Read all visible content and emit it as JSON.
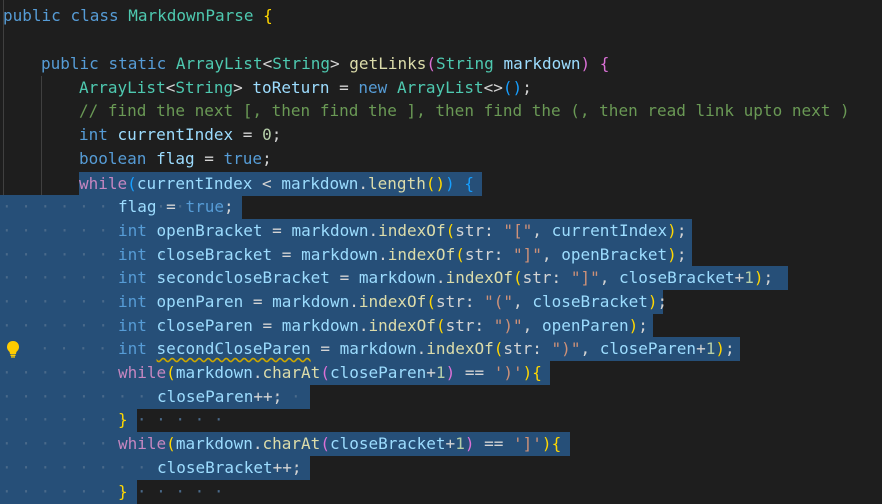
{
  "editor": {
    "language": "java",
    "theme_colors": {
      "background": "#1e1e1e",
      "selection": "#264f78",
      "keyword": "#569cd6",
      "control": "#c586c0",
      "type": "#4ec9b0",
      "function": "#dcdcaa",
      "variable": "#9cdcfe",
      "string": "#ce9178",
      "number": "#b5cea8",
      "comment": "#6a9955",
      "warning_squiggle": "#cca700"
    },
    "lightbulb_icon": "lightbulb-icon",
    "hint_label": "str:",
    "code": {
      "l1_a": "public",
      "l1_b": "class",
      "l1_c": "MarkdownParse",
      "l1_d": "{",
      "l3_a": "public",
      "l3_b": "static",
      "l3_c": "ArrayList",
      "l3_d": "<",
      "l3_e": "String",
      "l3_f": ">",
      "l3_g": "getLinks",
      "l3_h": "(",
      "l3_i": "String",
      "l3_j": "markdown",
      "l3_k": ")",
      "l3_l": "{",
      "l4_a": "ArrayList",
      "l4_b": "<",
      "l4_c": "String",
      "l4_d": ">",
      "l4_e": "toReturn",
      "l4_f": "=",
      "l4_g": "new",
      "l4_h": "ArrayList",
      "l4_i": "<>",
      "l4_j": "()",
      "l4_k": ";",
      "l5": "// find the next [, then find the ], then find the (, then read link upto next )",
      "l6_a": "int",
      "l6_b": "currentIndex",
      "l6_c": "=",
      "l6_d": "0",
      "l6_e": ";",
      "l7_a": "boolean",
      "l7_b": "flag",
      "l7_c": "=",
      "l7_d": "true",
      "l7_e": ";",
      "l8_a": "while",
      "l8_b": "(",
      "l8_c": "currentIndex",
      "l8_d": "<",
      "l8_e": "markdown",
      "l8_f": ".",
      "l8_g": "length",
      "l8_h": "()",
      "l8_i": ")",
      "l8_j": "{",
      "l9_a": "flag",
      "l9_b": "=",
      "l9_c": "true",
      "l9_d": ";",
      "l10_a": "int",
      "l10_b": "openBracket",
      "l10_c": "=",
      "l10_d": "markdown",
      "l10_e": ".",
      "l10_f": "indexOf",
      "l10_g": "(",
      "l10_h": "\"[\"",
      "l10_i": ",",
      "l10_j": "currentIndex",
      "l10_k": ")",
      "l10_l": ";",
      "l11_a": "int",
      "l11_b": "closeBracket",
      "l11_c": "=",
      "l11_d": "markdown",
      "l11_e": ".",
      "l11_f": "indexOf",
      "l11_g": "(",
      "l11_h": "\"]\"",
      "l11_i": ",",
      "l11_j": "openBracket",
      "l11_k": ")",
      "l11_l": ";",
      "l12_a": "int",
      "l12_b": "secondcloseBracket",
      "l12_c": "=",
      "l12_d": "markdown",
      "l12_e": ".",
      "l12_f": "indexOf",
      "l12_g": "(",
      "l12_h": "\"]\"",
      "l12_i": ",",
      "l12_j": "closeBracket",
      "l12_k": "+",
      "l12_l": "1",
      "l12_m": ")",
      "l12_n": ";",
      "l13_a": "int",
      "l13_b": "openParen",
      "l13_c": "=",
      "l13_d": "markdown",
      "l13_e": ".",
      "l13_f": "indexOf",
      "l13_g": "(",
      "l13_h": "\"(\"",
      "l13_i": ",",
      "l13_j": "closeBracket",
      "l13_k": ")",
      "l13_l": ";",
      "l14_a": "int",
      "l14_b": "closeParen",
      "l14_c": "=",
      "l14_d": "markdown",
      "l14_e": ".",
      "l14_f": "indexOf",
      "l14_g": "(",
      "l14_h": "\")\"",
      "l14_i": ",",
      "l14_j": "openParen",
      "l14_k": ")",
      "l14_l": ";",
      "l15_a": "int",
      "l15_b": "secondCloseParen",
      "l15_c": "=",
      "l15_d": "markdown",
      "l15_e": ".",
      "l15_f": "indexOf",
      "l15_g": "(",
      "l15_h": "\")\"",
      "l15_i": ",",
      "l15_j": "closeParen",
      "l15_k": "+",
      "l15_l": "1",
      "l15_m": ")",
      "l15_n": ";",
      "l16_a": "while",
      "l16_b": "(",
      "l16_c": "markdown",
      "l16_d": ".",
      "l16_e": "charAt",
      "l16_f": "(",
      "l16_g": "closeParen",
      "l16_h": "+",
      "l16_i": "1",
      "l16_j": ")",
      "l16_k": "==",
      "l16_l": "')'",
      "l16_m": ")",
      "l16_n": "{",
      "l17_a": "closeParen",
      "l17_b": "++;",
      "l18": "}",
      "l19_a": "while",
      "l19_b": "(",
      "l19_c": "markdown",
      "l19_d": ".",
      "l19_e": "charAt",
      "l19_f": "(",
      "l19_g": "closeBracket",
      "l19_h": "+",
      "l19_i": "1",
      "l19_j": ")",
      "l19_k": "==",
      "l19_l": "']'",
      "l19_m": ")",
      "l19_n": "{",
      "l20_a": "closeBracket",
      "l20_b": "++;",
      "l21": "}"
    }
  }
}
